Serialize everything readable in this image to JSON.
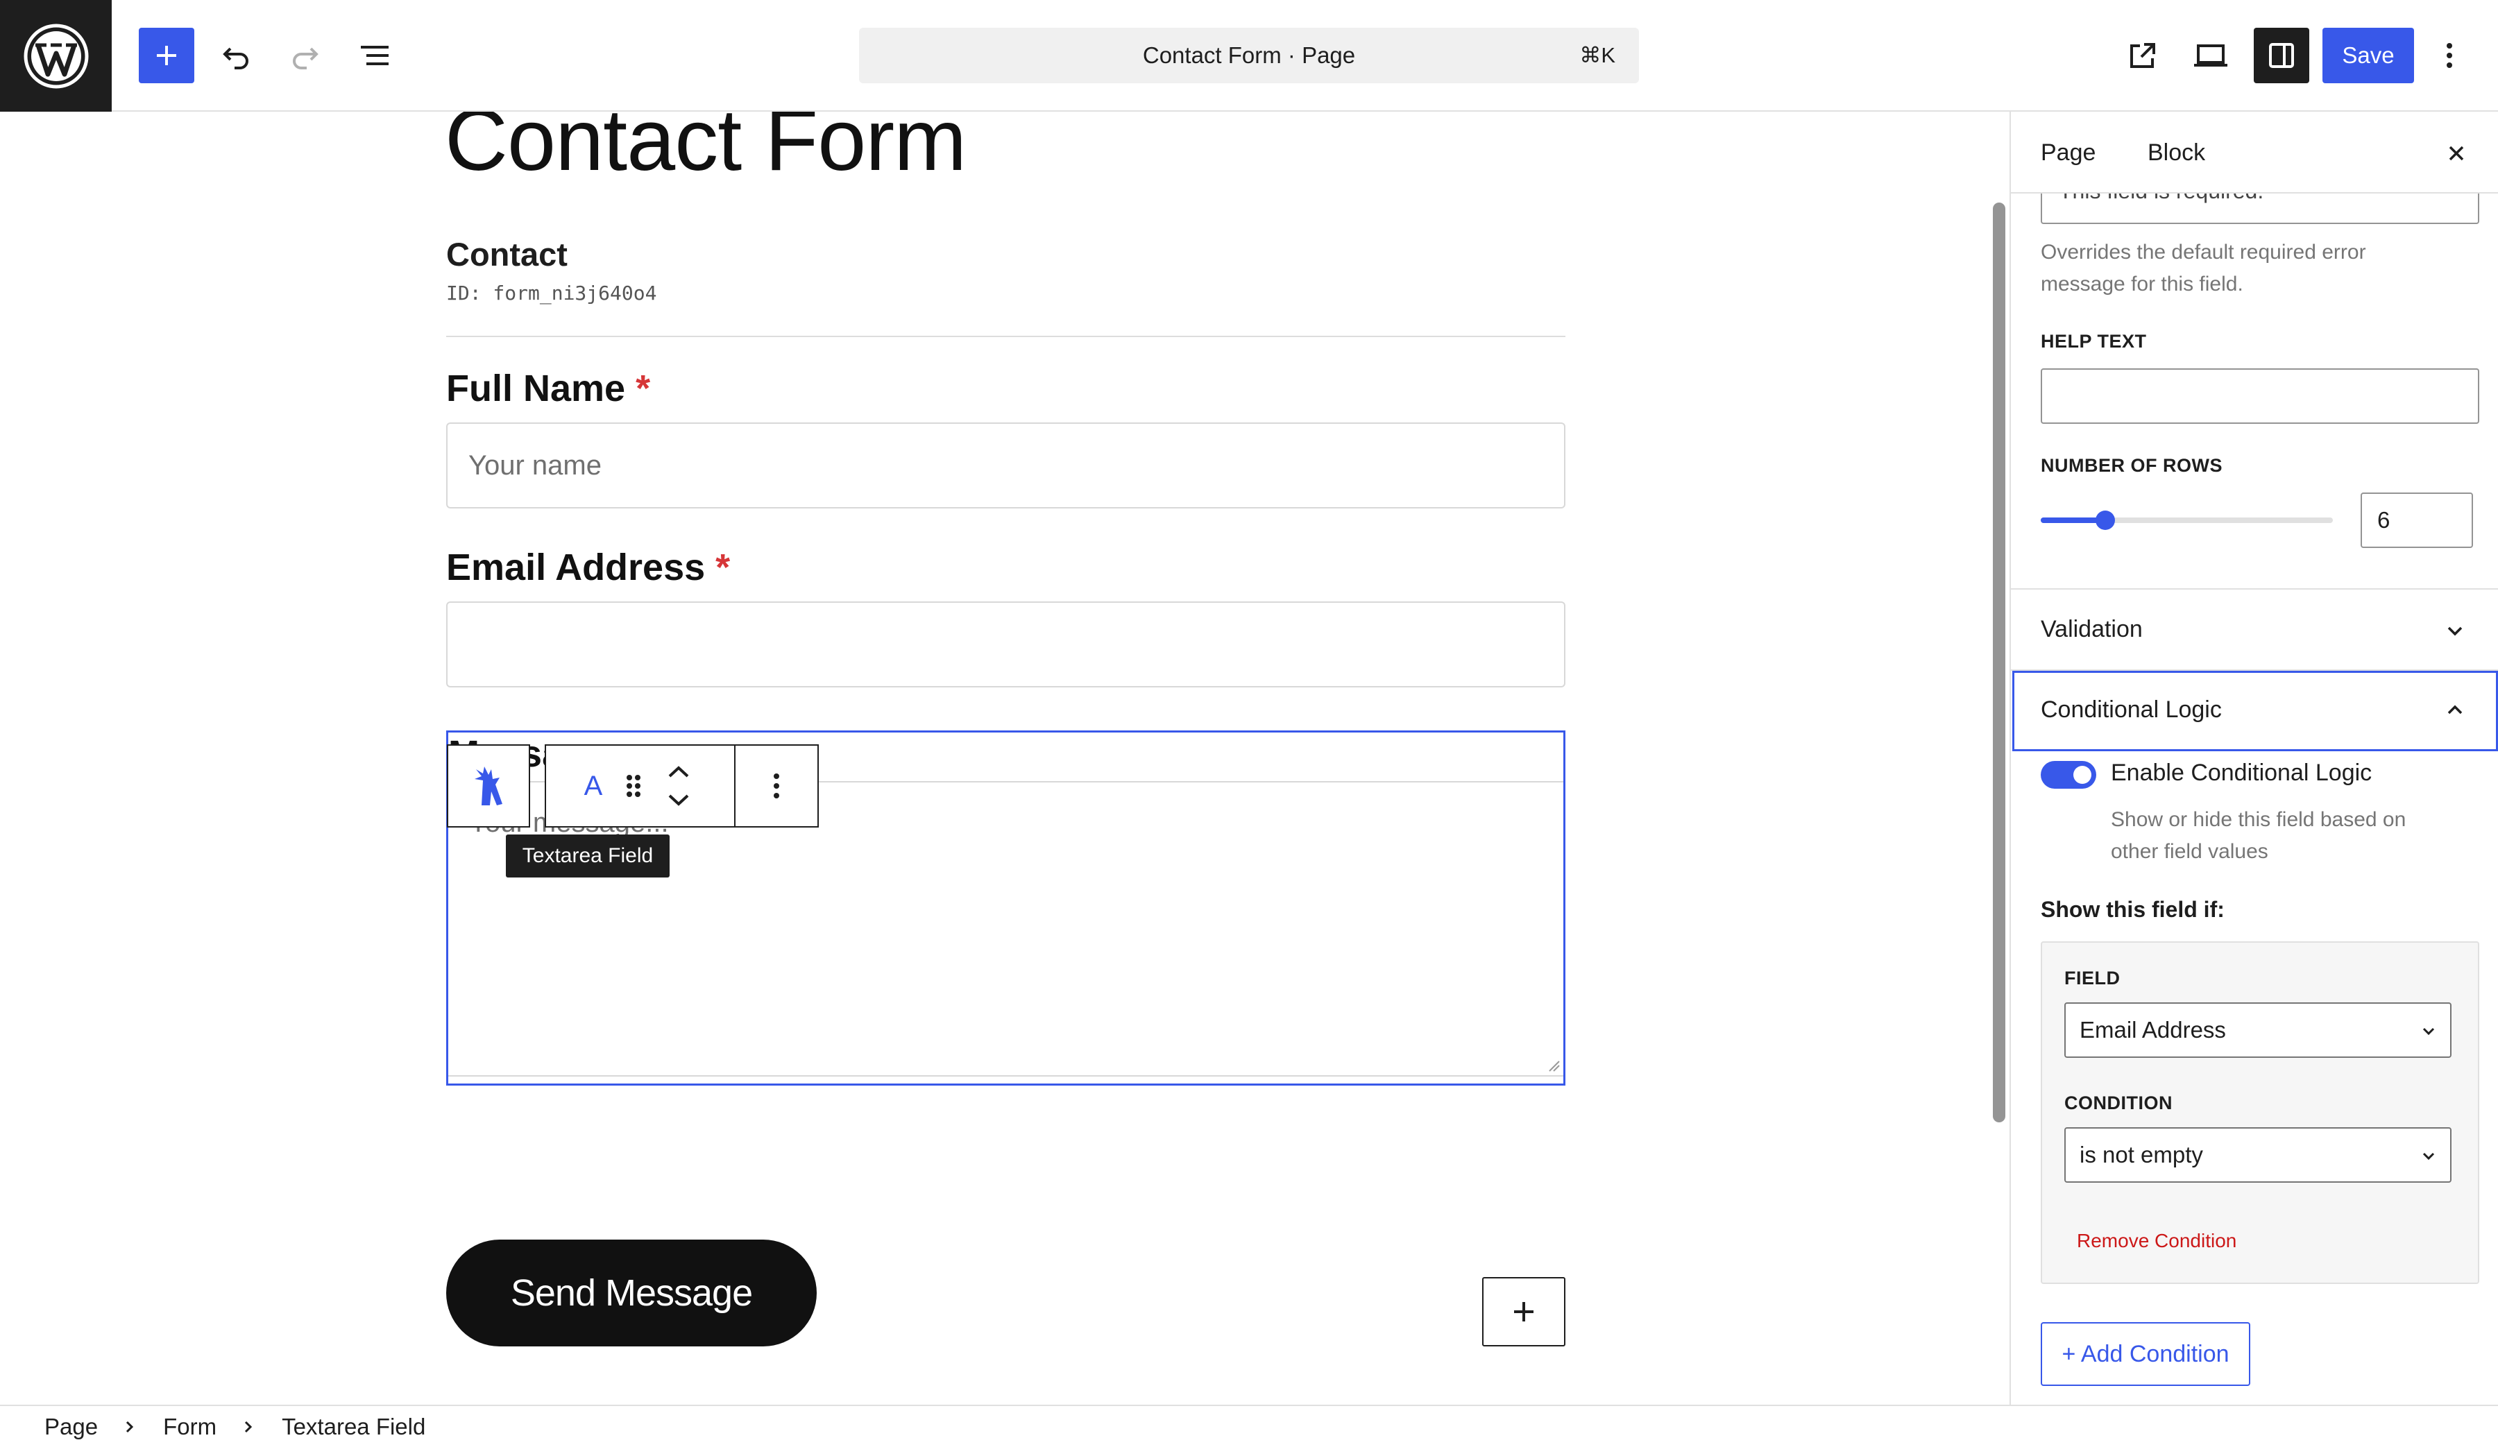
{
  "topbar": {
    "document_title": "Contact Form · Page",
    "shortcut": "⌘K",
    "save_label": "Save",
    "icons": [
      "wordpress-logo",
      "plus-icon",
      "undo-icon",
      "redo-icon",
      "list-view-icon",
      "external-link-icon",
      "device-preview-icon",
      "sidebar-icon",
      "more-vertical-icon"
    ],
    "accent_color": "#3858e9"
  },
  "canvas": {
    "page_title": "Contact Form",
    "form": {
      "title": "Contact",
      "id_text": "ID: form_ni3j640o4",
      "fields": [
        {
          "label": "Full Name",
          "required_mark": "*",
          "placeholder": "Your name"
        },
        {
          "label": "Email Address",
          "required_mark": "*",
          "placeholder": ""
        },
        {
          "label": "Message",
          "placeholder": "Your message..."
        }
      ],
      "submit_label": "Send Message"
    },
    "block_toolbar": {
      "tooltip": "Textarea Field",
      "text_format_glyph": "A"
    }
  },
  "sidebar": {
    "tabs": [
      "Page",
      "Block"
    ],
    "required_message_value": "This field is required.",
    "required_message_help": [
      "Overrides the default required error",
      "message for this field."
    ],
    "help_text_label": "HELP TEXT",
    "help_text_value": "",
    "rows_label": "NUMBER OF ROWS",
    "rows_value": "6",
    "rows_slider_fraction": 0.22,
    "validation_title": "Validation",
    "conditional_title": "Conditional Logic",
    "enable_label": "Enable Conditional Logic",
    "enable_on": true,
    "enable_help": [
      "Show or hide this field based on",
      "other field values"
    ],
    "show_if_label": "Show this field if:",
    "field_label": "FIELD",
    "field_value": "Email Address",
    "condition_label": "CONDITION",
    "condition_value": "is not empty",
    "remove_label": "Remove Condition",
    "add_label": "+ Add Condition"
  },
  "footer": {
    "breadcrumbs": [
      "Page",
      "Form",
      "Textarea Field"
    ]
  }
}
